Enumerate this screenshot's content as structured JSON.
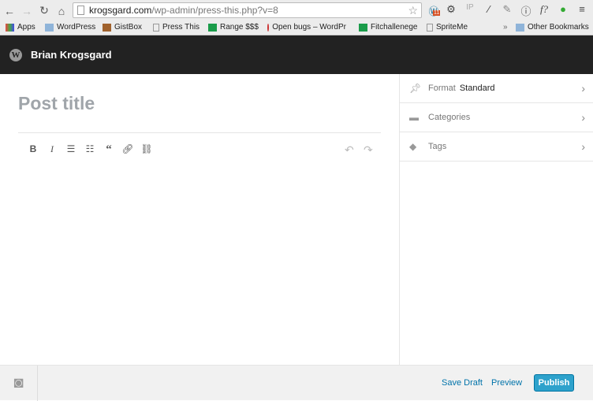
{
  "browser": {
    "url_host": "krogsgard.com",
    "url_path": "/wp-admin/press-this.php?v=8",
    "wp_badge": "11",
    "bookmarks": [
      "Apps",
      "WordPress",
      "GistBox",
      "Press This",
      "Range $$$",
      "Open bugs – WordPr",
      "Fitchallenege",
      "SpriteMe"
    ],
    "overflow": "»",
    "other_bookmarks": "Other Bookmarks"
  },
  "header": {
    "site_name": "Brian Krogsgard"
  },
  "editor": {
    "title_placeholder": "Post title"
  },
  "sidebar": {
    "format_label": "Format",
    "format_value": "Standard",
    "categories_label": "Categories",
    "tags_label": "Tags"
  },
  "footer": {
    "save_draft": "Save Draft",
    "preview": "Preview",
    "publish": "Publish"
  },
  "colors": {
    "accent": "#2ea2cc",
    "header_bg": "#222222",
    "link": "#0073aa"
  }
}
